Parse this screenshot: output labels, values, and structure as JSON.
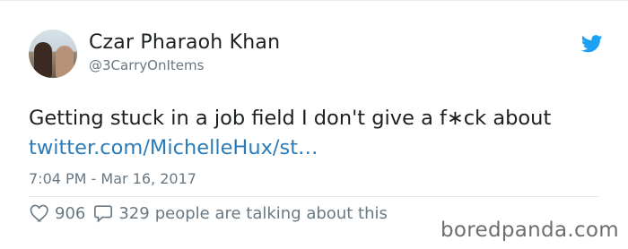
{
  "author": {
    "name": "Czar Pharaoh Khan",
    "handle": "@3CarryOnItems"
  },
  "tweet": {
    "text": "Getting stuck in a job field I don't give a f∗ck about",
    "link": "twitter.com/MichelleHux/st…",
    "timestamp": "7:04 PM - Mar 16, 2017"
  },
  "stats": {
    "likes": "906",
    "replies": "329",
    "talking": "people are talking about this"
  },
  "watermark": "boredpanda.com",
  "icons": {
    "brand": "twitter-bird-icon",
    "like": "heart-icon",
    "reply": "speech-bubble-icon"
  },
  "colors": {
    "link": "#2b7bb9",
    "twitter_blue": "#1da1f2",
    "muted": "#697882",
    "text": "#1c2022"
  }
}
